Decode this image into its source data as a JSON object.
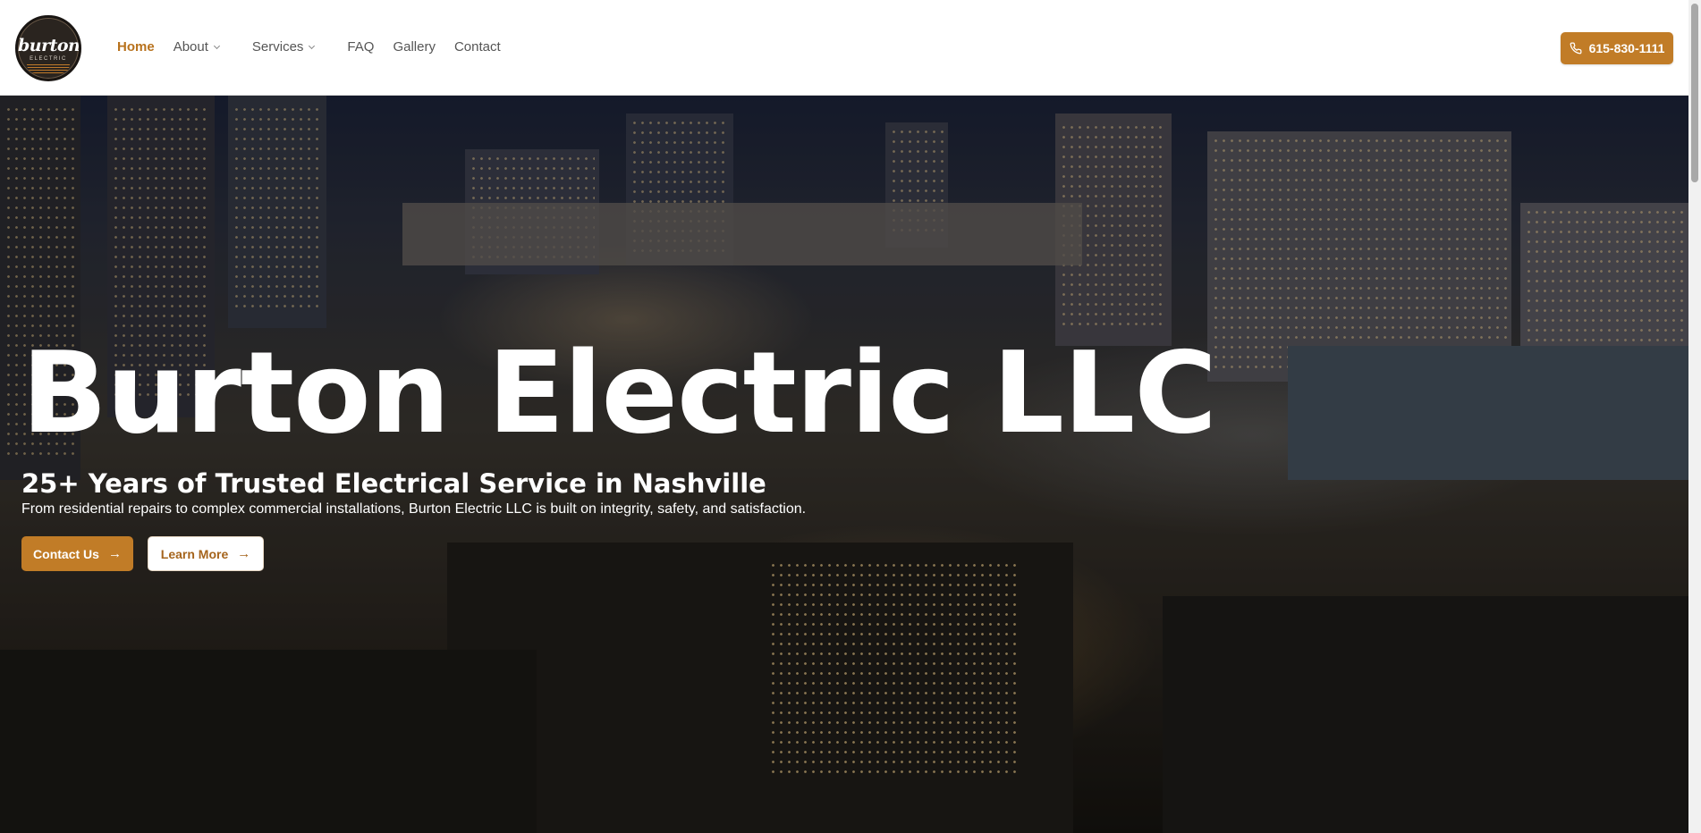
{
  "brand": {
    "logo_word": "burton",
    "logo_sub": "ELECTRIC"
  },
  "nav": {
    "items": [
      {
        "label": "Home",
        "active": true
      },
      {
        "label": "About",
        "has_dropdown": true
      },
      {
        "label": "Services",
        "has_dropdown": true
      },
      {
        "label": "FAQ"
      },
      {
        "label": "Gallery"
      },
      {
        "label": "Contact"
      }
    ]
  },
  "header": {
    "phone_label": "615-830-1111",
    "phone_icon": "phone-icon"
  },
  "hero": {
    "title": "Burton Electric LLC",
    "subtitle": "25+ Years of Trusted Electrical Service in Nashville",
    "description": "From residential repairs to complex commercial installations, Burton Electric LLC is built on integrity, safety, and satisfaction.",
    "primary_cta": "Contact Us",
    "secondary_cta": "Learn More",
    "cta_icon": "arrow-right-icon"
  },
  "colors": {
    "accent": "#c17c27",
    "active_nav": "#b8721d",
    "nav_text": "#555555"
  }
}
